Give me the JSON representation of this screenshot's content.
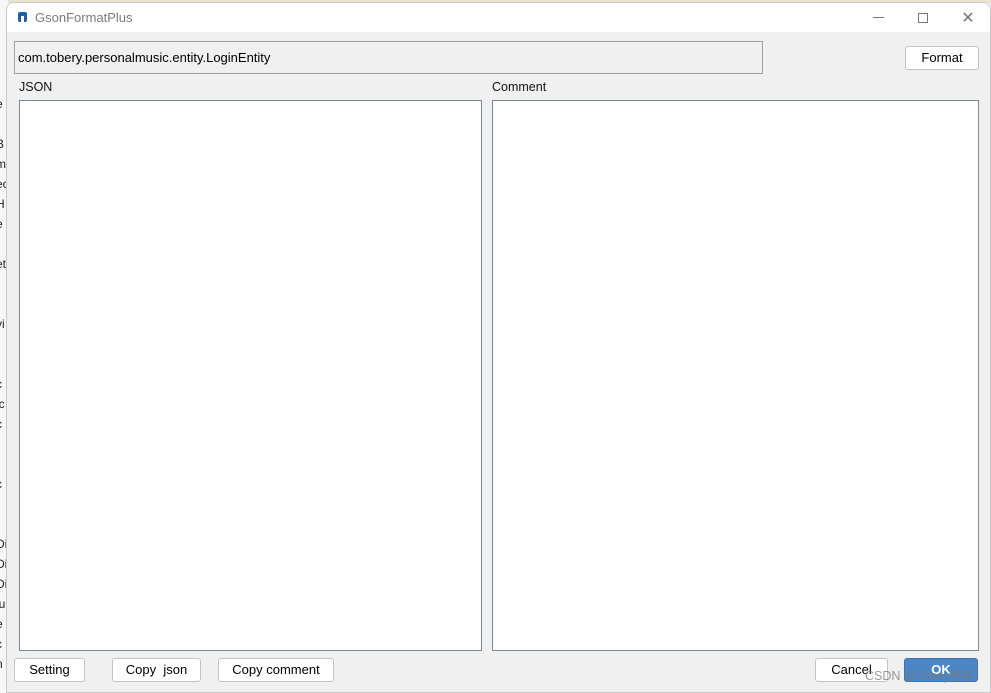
{
  "window": {
    "title": "GsonFormatPlus",
    "controls": {
      "minimize": "minimize",
      "maximize": "maximize",
      "close": "✕"
    }
  },
  "class_field": {
    "value": "com.tobery.personalmusic.entity.LoginEntity"
  },
  "buttons": {
    "format": "Format",
    "setting": "Setting",
    "copy_json": "Copy  json",
    "copy_comment": "Copy comment",
    "cancel": "Cancel",
    "ok": "OK"
  },
  "panels": {
    "json_label": "JSON",
    "comment_label": "Comment",
    "json_value": "",
    "comment_value": ""
  },
  "background_fragments": [
    "e",
    "",
    "B",
    "m",
    "ec",
    "H",
    "e",
    "r",
    "et",
    "",
    "t",
    "vi",
    "",
    "",
    "c",
    "ic",
    "c",
    "",
    "",
    "c",
    "",
    "",
    "Di",
    "Di",
    "Di",
    "iu",
    "e",
    "c",
    "n"
  ],
  "watermark": "CSDN @Tobey博客",
  "colors": {
    "ok_button": "#4a86c8",
    "panel_border": "#7a8899",
    "window_bg": "#f0f0f0"
  }
}
